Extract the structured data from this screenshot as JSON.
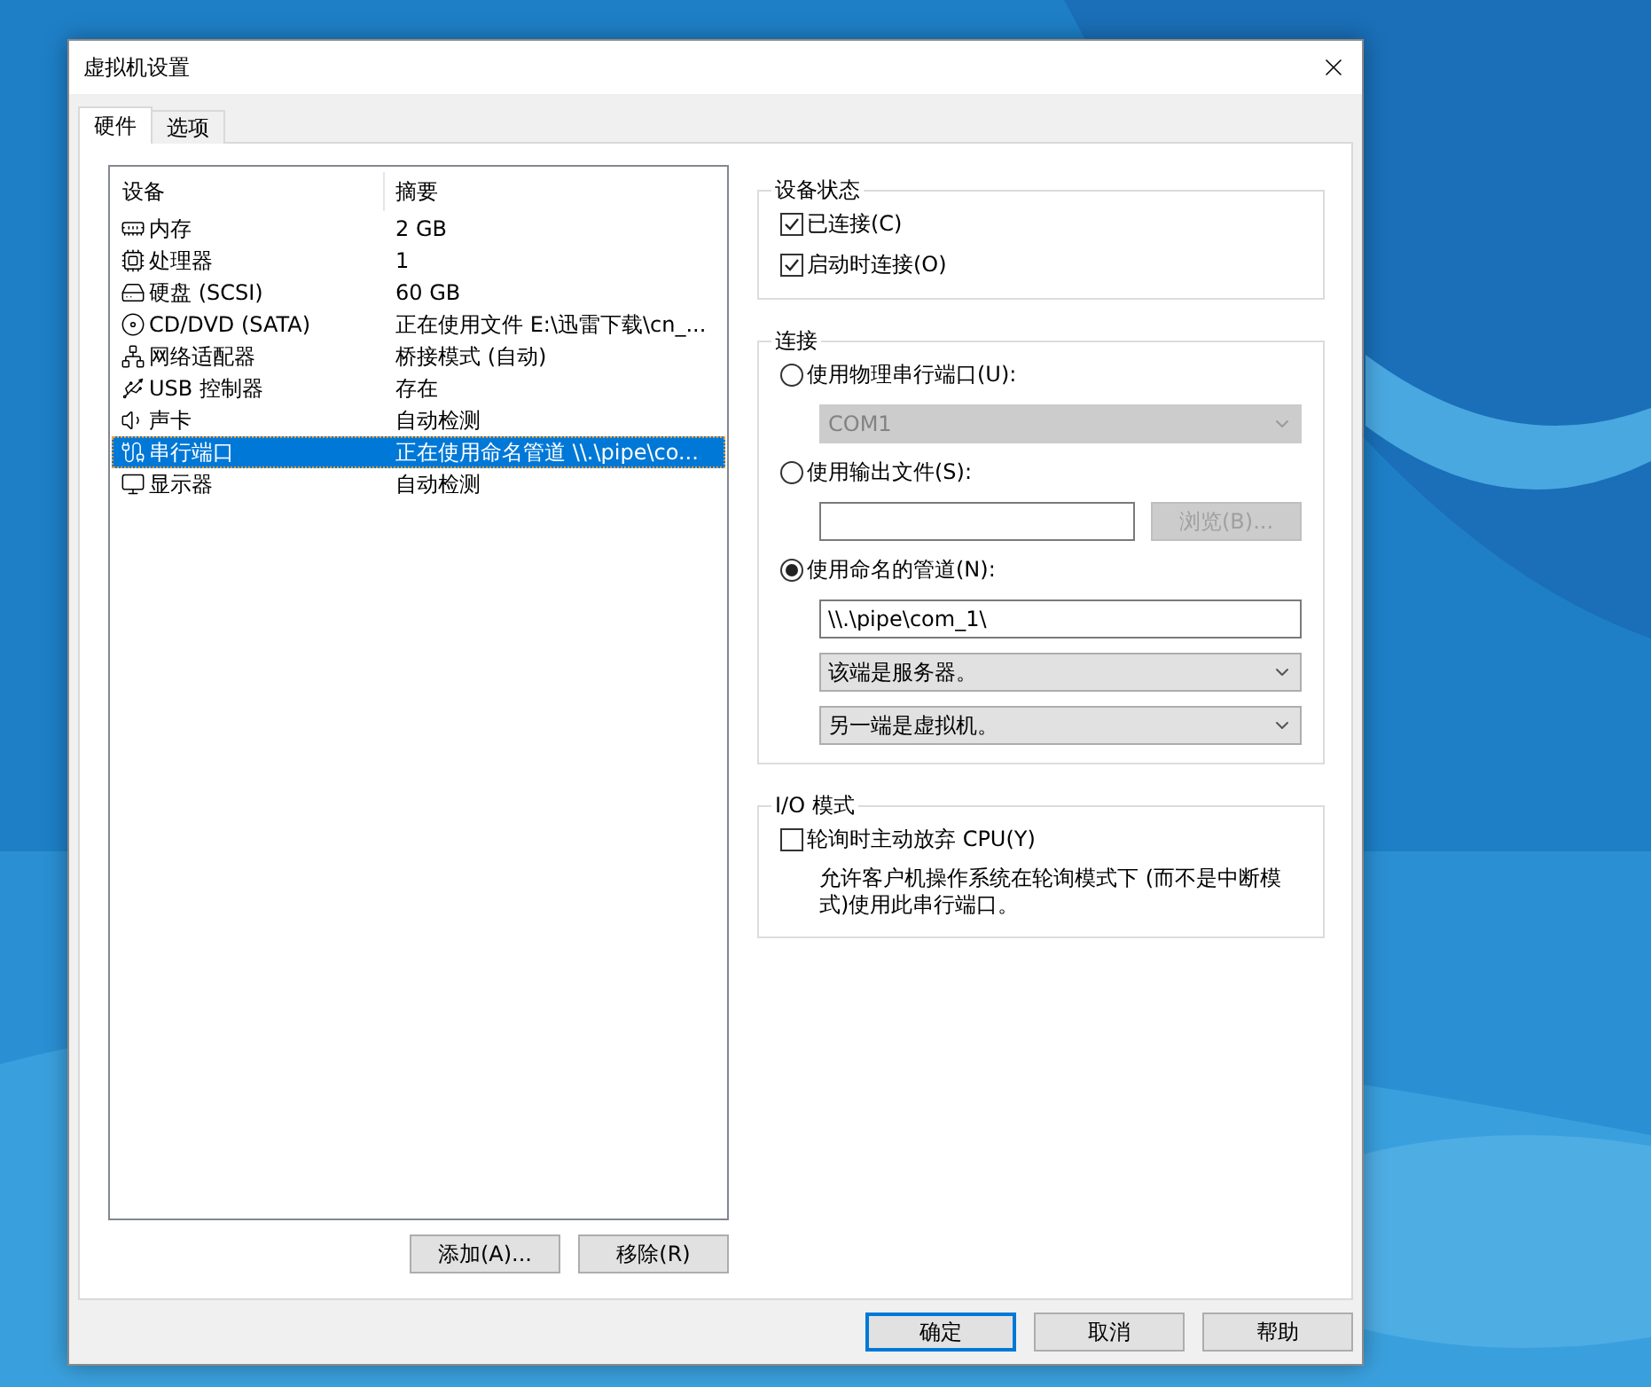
{
  "window": {
    "title": "虚拟机设置"
  },
  "tabs": [
    {
      "label": "硬件",
      "selected": true
    },
    {
      "label": "选项",
      "selected": false
    }
  ],
  "devices": {
    "columns": [
      "设备",
      "摘要"
    ],
    "rows": [
      {
        "kind": "memory",
        "name": "内存",
        "summary": "2 GB",
        "selected": false
      },
      {
        "kind": "cpu",
        "name": "处理器",
        "summary": "1",
        "selected": false
      },
      {
        "kind": "disk",
        "name": "硬盘 (SCSI)",
        "summary": "60 GB",
        "selected": false
      },
      {
        "kind": "cdrom",
        "name": "CD/DVD (SATA)",
        "summary": "正在使用文件 E:\\迅雷下载\\cn_...",
        "selected": false
      },
      {
        "kind": "network",
        "name": "网络适配器",
        "summary": "桥接模式 (自动)",
        "selected": false
      },
      {
        "kind": "usb",
        "name": "USB 控制器",
        "summary": "存在",
        "selected": false
      },
      {
        "kind": "sound",
        "name": "声卡",
        "summary": "自动检测",
        "selected": false
      },
      {
        "kind": "serial",
        "name": "串行端口",
        "summary": "正在使用命名管道 \\\\.\\pipe\\co...",
        "selected": true
      },
      {
        "kind": "display",
        "name": "显示器",
        "summary": "自动检测",
        "selected": false
      }
    ],
    "buttons": [
      "添加(A)...",
      "移除(R)"
    ]
  },
  "device_status": {
    "title": "设备状态",
    "options": [
      {
        "label": "已连接(C)",
        "checked": true
      },
      {
        "label": "启动时连接(O)",
        "checked": true
      }
    ]
  },
  "connection": {
    "title": "连接",
    "physical": {
      "label": "使用物理串行端口(U):",
      "selected": false,
      "port": {
        "value": "COM1",
        "disabled": true
      }
    },
    "output_file": {
      "label": "使用输出文件(S):",
      "selected": false,
      "browse": {
        "label": "浏览(B)...",
        "disabled": true
      }
    },
    "named_pipe": {
      "label": "使用命名的管道(N):",
      "selected": true,
      "path": "\\\\.\\pipe\\com_1\\",
      "this_end": "该端是服务器。",
      "other_end": "另一端是虚拟机。"
    }
  },
  "io_mode": {
    "title": "I/O 模式",
    "option": {
      "label": "轮询时主动放弃 CPU(Y)",
      "checked": false
    },
    "description": "允许客户机操作系统在轮询模式下 (而不是中断模式)使用此串行端口。"
  },
  "footer_buttons": [
    {
      "label": "确定",
      "default": true
    },
    {
      "label": "取消",
      "default": false
    },
    {
      "label": "帮助",
      "default": false
    }
  ]
}
